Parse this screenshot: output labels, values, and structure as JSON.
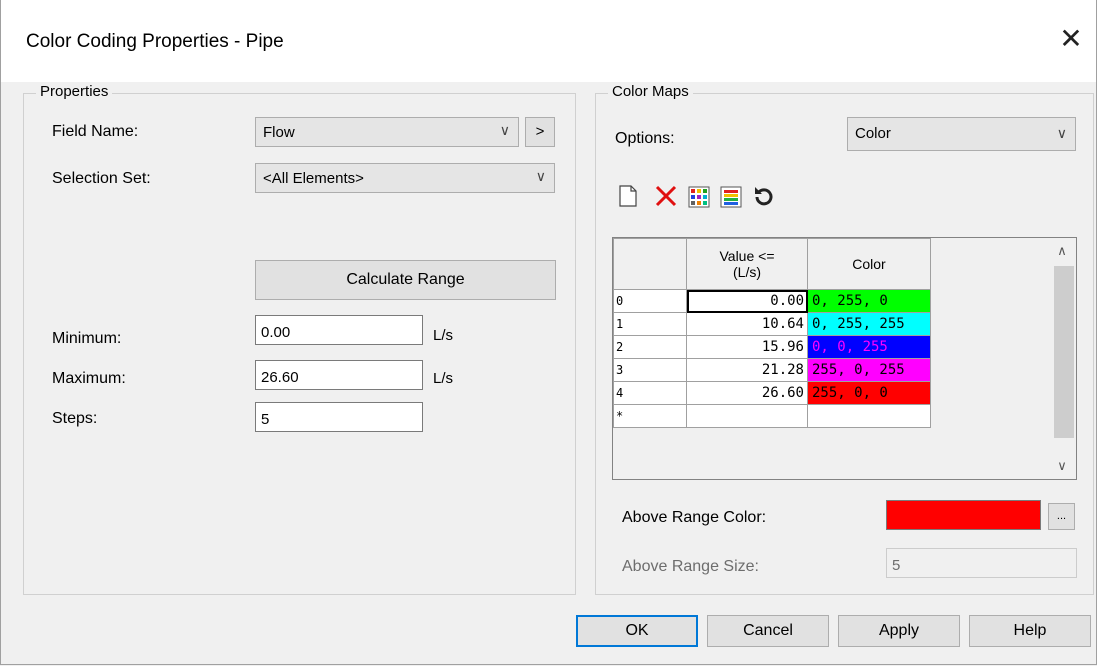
{
  "window": {
    "title": "Color Coding Properties - Pipe",
    "close_glyph": "✕"
  },
  "properties": {
    "group_label": "Properties",
    "field_name_label": "Field Name:",
    "field_name_value": "Flow",
    "field_more_label": ">",
    "selection_set_label": "Selection Set:",
    "selection_set_value": "<All Elements>",
    "calc_range_label": "Calculate Range",
    "minimum_label": "Minimum:",
    "minimum_value": "0.00",
    "minimum_unit": "L/s",
    "maximum_label": "Maximum:",
    "maximum_value": "26.60",
    "maximum_unit": "L/s",
    "steps_label": "Steps:",
    "steps_value": "5"
  },
  "color_maps": {
    "group_label": "Color Maps",
    "options_label": "Options:",
    "options_value": "Color",
    "toolbar": [
      "new-icon",
      "delete-icon",
      "color-palette-icon",
      "color-ramp-icon",
      "reset-icon"
    ],
    "columns": {
      "value_line1": "Value <=",
      "value_line2": "(L/s)",
      "color": "Color"
    },
    "rows": [
      {
        "index": "0",
        "value": "0.00",
        "color_text": "0, 255, 0",
        "color": "#00ff00"
      },
      {
        "index": "1",
        "value": "10.64",
        "color_text": "0, 255, 255",
        "color": "#00ffff"
      },
      {
        "index": "2",
        "value": "15.96",
        "color_text": "0, 0, 255",
        "color": "#0000ff"
      },
      {
        "index": "3",
        "value": "21.28",
        "color_text": "255, 0, 255",
        "color": "#ff00ff"
      },
      {
        "index": "4",
        "value": "26.60",
        "color_text": "255, 0, 0",
        "color": "#ff0000"
      }
    ],
    "new_row_marker": "*",
    "above_range_color_label": "Above Range Color:",
    "above_range_color": "#ff0000",
    "above_range_more_label": "...",
    "above_range_size_label": "Above Range Size:",
    "above_range_size_value": "5"
  },
  "buttons": {
    "ok": "OK",
    "cancel": "Cancel",
    "apply": "Apply",
    "help": "Help"
  },
  "glyphs": {
    "dropdown": "∨",
    "scroll_up": "∧",
    "scroll_down": "∨"
  }
}
